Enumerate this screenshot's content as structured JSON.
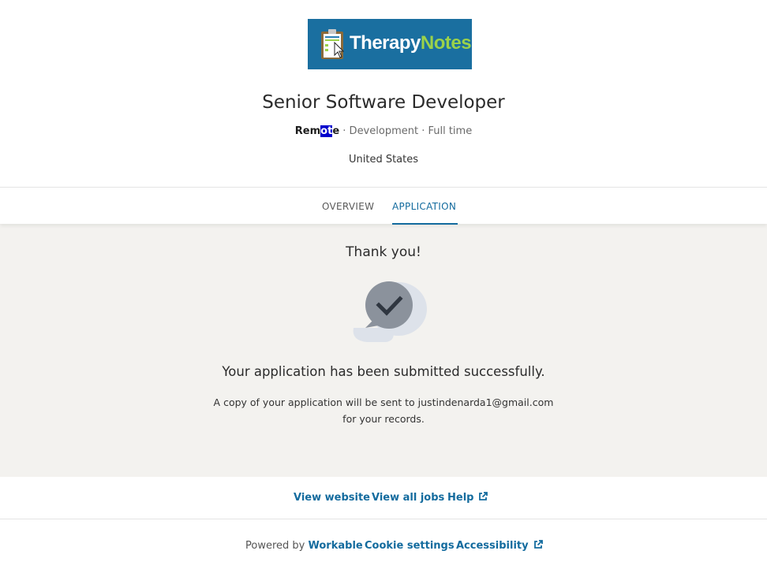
{
  "company": {
    "logo_text_primary": "Therapy",
    "logo_text_secondary": "Notes",
    "logo_clip_text": "Therapy Notes",
    "brand_color": "#1a6fa0",
    "accent_color": "#9bd24a"
  },
  "job": {
    "title": "Senior Software Developer",
    "workplace_prefix": "Rem",
    "workplace_highlight": "ot",
    "workplace_suffix": "e",
    "department_and_type": " · Development · Full time",
    "location": "United States"
  },
  "tabs": [
    {
      "label": "OVERVIEW",
      "active": false
    },
    {
      "label": "APPLICATION",
      "active": true
    }
  ],
  "confirmation": {
    "heading": "Thank you!",
    "icon": "chat-check-icon",
    "message": "Your application has been submitted successfully.",
    "copy_line1": "A copy of your application will be sent to justindenarda1@gmail.com",
    "copy_line2": "for your records."
  },
  "footer": {
    "view_website": "View website",
    "view_all_jobs": "View all jobs",
    "help": "Help",
    "powered_by": "Powered by",
    "workable": "Workable",
    "cookie_settings": "Cookie settings",
    "accessibility": "Accessibility",
    "link_color": "#136b9e"
  }
}
